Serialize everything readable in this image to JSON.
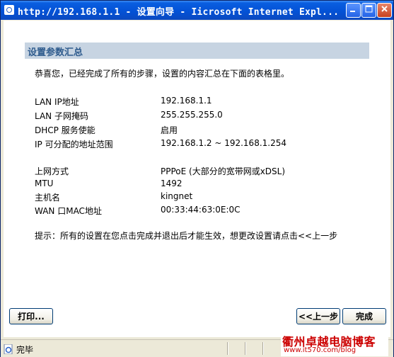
{
  "window": {
    "title": "http://192.168.1.1 - 设置向导 - Iicrosoft Internet Expl...",
    "minimize_icon": "minimize-icon",
    "maximize_icon": "maximize-icon",
    "close_icon": "close-icon"
  },
  "section": {
    "title": "设置参数汇总",
    "intro": "恭喜您，已经完成了所有的步骤，设置的内容汇总在下面的表格里。"
  },
  "summary": {
    "lan_ip_label": "LAN IP地址",
    "lan_ip_value": "192.168.1.1",
    "lan_mask_label": "LAN 子网掩码",
    "lan_mask_value": "255.255.255.0",
    "dhcp_label": "DHCP 服务使能",
    "dhcp_value": "启用",
    "ip_range_label": "IP 可分配的地址范围",
    "ip_range_value": "192.168.1.2 ~ 192.168.1.254",
    "wan_type_label": "上网方式",
    "wan_type_value": "PPPoE (大部分的宽带网或xDSL)",
    "mtu_label": "MTU",
    "mtu_value": "1492",
    "hostname_label": "主机名",
    "hostname_value": "kingnet",
    "wan_mac_label": "WAN 口MAC地址",
    "wan_mac_value": "00:33:44:63:0E:0C"
  },
  "hint": "提示：所有的设置在您点击完成并退出后才能生效，想更改设置请点击<<上一步",
  "buttons": {
    "print": "打印...",
    "back": "<<上一步",
    "finish": "完成"
  },
  "status": {
    "text": "完毕",
    "icon": "ie-page-icon"
  },
  "watermark": {
    "line1": "衢州卓越电脑博客",
    "line2": "www.it570.com/blog"
  },
  "colors": {
    "titlebar": "#0352d6",
    "section_bg": "#c7d4e2",
    "section_text": "#2f5c8e",
    "watermark": "#cc0000"
  }
}
